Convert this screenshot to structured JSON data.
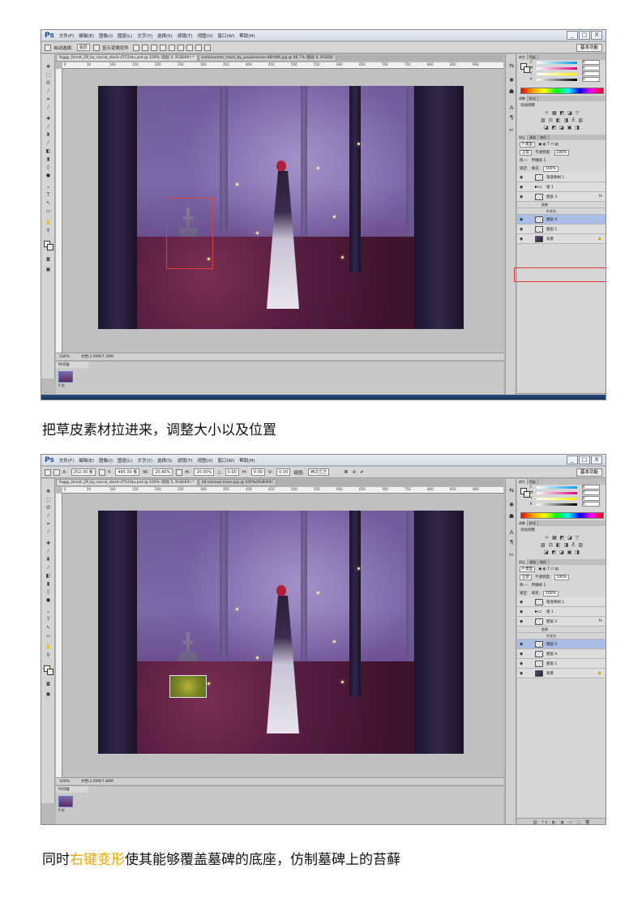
{
  "menu": {
    "logo": "Ps",
    "items": [
      "文件(F)",
      "编辑(E)",
      "图像(I)",
      "图层(L)",
      "文字(Y)",
      "选择(S)",
      "滤镜(T)",
      "视图(V)",
      "窗口(W)",
      "帮助(H)"
    ],
    "window_buttons": [
      "_",
      "□",
      "X"
    ]
  },
  "workspace": "基本功能",
  "shot1": {
    "options": {
      "auto_select_label": "自动选择:",
      "auto_select_value": "图层",
      "transform_controls": "显示变换控件"
    },
    "tabs": [
      "foggy_forest_29_by_sacral_stock-d753rbu.psd @ 100% (图层 4, RGB/8#) *",
      "luminosome_moss_by_paulomecon-d6hfbft.jpg @ 66.7% (图层 0, RGB/8)"
    ],
    "zoom": "100%",
    "doc_size": "文档:2.00M/7.34M",
    "layers": [
      {
        "name": "渐变映射 1",
        "type": "adjust",
        "selected": false
      },
      {
        "name": "组 1",
        "type": "folder",
        "selected": false
      },
      {
        "name": "图层 3",
        "type": "layer",
        "fx": "fx",
        "selected": false
      },
      {
        "name": "效果",
        "type": "sub"
      },
      {
        "name": "外发光",
        "type": "sub"
      },
      {
        "name": "图层 4",
        "type": "layer",
        "selected": true
      },
      {
        "name": "图层 1",
        "type": "layer",
        "selected": false
      },
      {
        "name": "背景",
        "type": "background",
        "selected": false
      }
    ],
    "caption": "把草皮素材拉进来，调整大小以及位置"
  },
  "shot2": {
    "options": {
      "x_label": "X:",
      "x_value": "252.00 像",
      "y_label": "Y:",
      "y_value": "495.00 像",
      "w_label": "W:",
      "w_value": "20.40%",
      "h_label": "H:",
      "h_value": "20.00%",
      "angle_value": "0.00",
      "hskew_label": "H:",
      "hskew_value": "0.00",
      "vskew_label": "V:",
      "vskew_value": "0.00",
      "interp_label": "插值:",
      "interp_value": "两次立方"
    },
    "tabs": [
      "foggy_forest_29_by_sacral_stock-d753rbu.psd @ 100% (图层 5, RGB/8#) *",
      "18-closeup-moss.jpg @ 100%(RGB/8#)"
    ],
    "zoom": "100%",
    "doc_size": "文档:2.00M/7.80M",
    "layers": [
      {
        "name": "渐变映射 1",
        "type": "adjust",
        "selected": false
      },
      {
        "name": "组 1",
        "type": "folder",
        "selected": false
      },
      {
        "name": "图层 3",
        "type": "layer",
        "fx": "fx",
        "selected": false
      },
      {
        "name": "效果",
        "type": "sub"
      },
      {
        "name": "外发光",
        "type": "sub"
      },
      {
        "name": "图层 5",
        "type": "layer",
        "selected": true
      },
      {
        "name": "图层 4",
        "type": "layer",
        "selected": false
      },
      {
        "name": "图层 1",
        "type": "layer",
        "selected": false
      },
      {
        "name": "背景",
        "type": "background",
        "selected": false
      }
    ],
    "caption_pre": "同时",
    "caption_hl": "右键变形",
    "caption_post": "使其能够覆盖墓碑的底座，仿制墓碑上的苔藓"
  },
  "panels": {
    "color_tabs": [
      "颜色",
      "色板"
    ],
    "sliders": [
      {
        "label": "C",
        "value": "0",
        "unit": "%"
      },
      {
        "label": "M",
        "value": "0",
        "unit": "%"
      },
      {
        "label": "Y",
        "value": "0",
        "unit": "%"
      },
      {
        "label": "K",
        "value": "0",
        "unit": "%"
      }
    ],
    "adjust_tabs": [
      "调整",
      "样式"
    ],
    "adjust_title": "添加调整",
    "layer_tabs": [
      "图层",
      "通道",
      "路径"
    ],
    "kind_label": "P 类型",
    "blend_mode": "正常",
    "opacity_label": "不透明度:",
    "opacity_value": "100%",
    "unify_label": "统一:",
    "propagate_label": "传播帧 1",
    "lock_label": "锁定:",
    "fill_label": "填充:",
    "fill_value": "100%"
  },
  "timeline": {
    "title": "时间轴",
    "frame_time": "0 秒"
  },
  "colors": {
    "accent_red": "#e23b3b",
    "caption_highlight": "#f0a400",
    "selected_layer": "#a9bde6"
  }
}
